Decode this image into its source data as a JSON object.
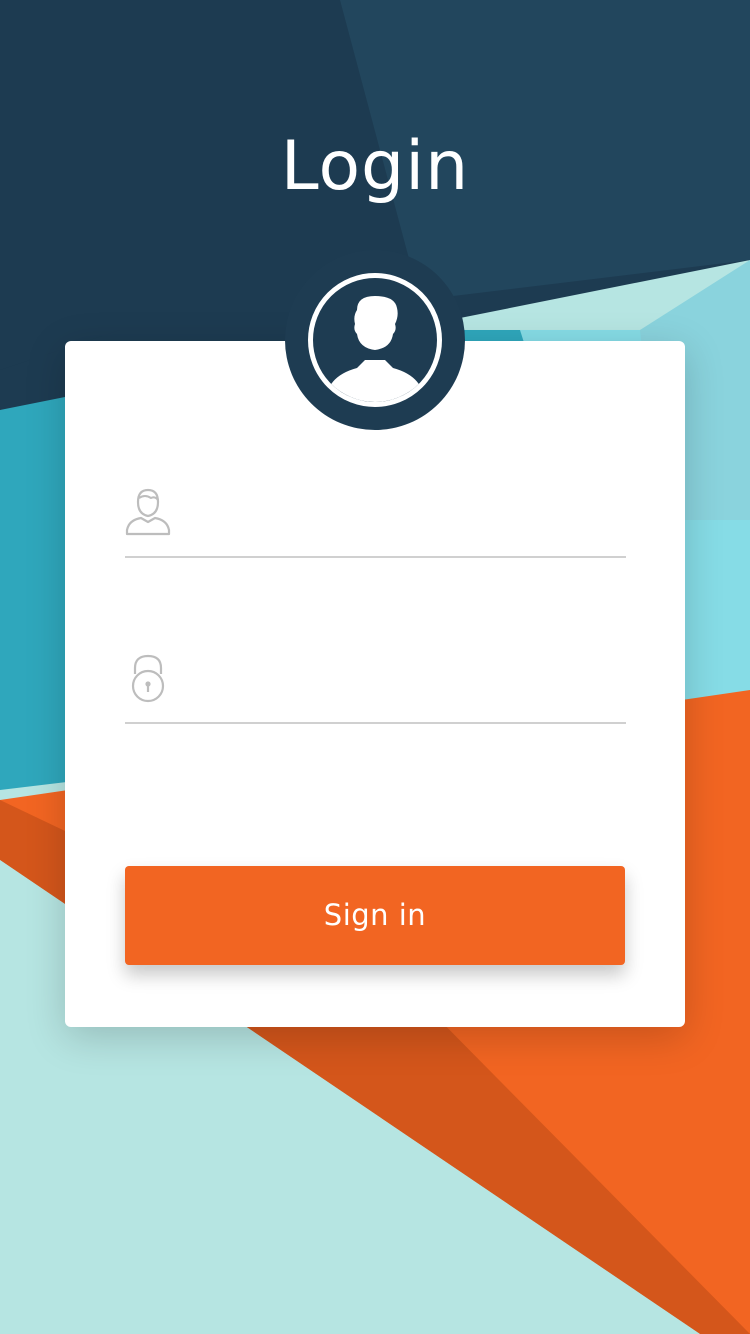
{
  "header": {
    "title": "Login"
  },
  "form": {
    "username": {
      "value": "",
      "placeholder": "",
      "icon": "user-outline-icon"
    },
    "password": {
      "value": "",
      "placeholder": "",
      "icon": "lock-icon"
    },
    "submit_label": "Sign in"
  },
  "avatar": {
    "icon": "user-silhouette-icon"
  },
  "colors": {
    "navy": "#1e3c52",
    "teal": "#2fa8bd",
    "light_teal": "#b6e5e2",
    "orange": "#f26522",
    "white": "#ffffff"
  }
}
